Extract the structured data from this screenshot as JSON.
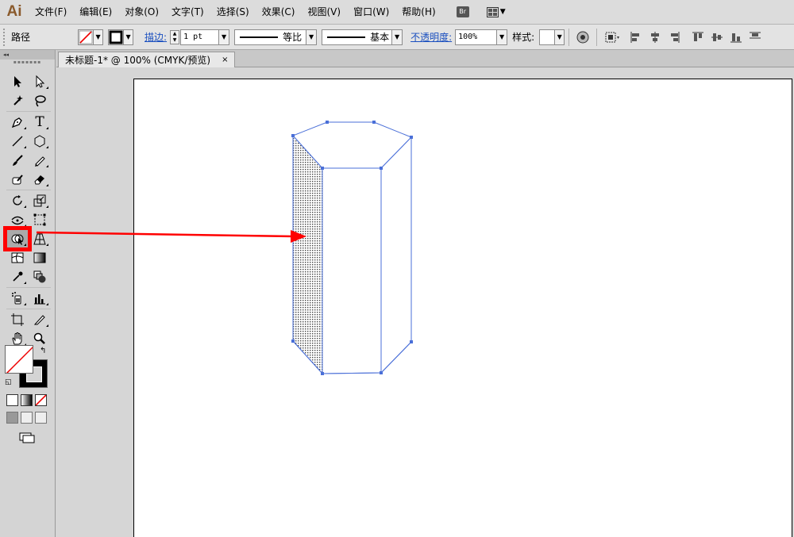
{
  "app": {
    "logo": "Ai"
  },
  "menu": {
    "items": [
      "文件(F)",
      "编辑(E)",
      "对象(O)",
      "文字(T)",
      "选择(S)",
      "效果(C)",
      "视图(V)",
      "窗口(W)",
      "帮助(H)"
    ],
    "bridge_label": "Br"
  },
  "control": {
    "selection_label": "路径",
    "stroke_label": "描边:",
    "stroke_weight": "1 pt",
    "stroke_ratio_label": "等比",
    "profile_label": "基本",
    "opacity_label": "不透明度:",
    "opacity_value": "100%",
    "style_label": "样式:"
  },
  "document": {
    "tab_title": "未标题-1* @ 100% (CMYK/预览)",
    "close_glyph": "×"
  },
  "toolpanel": {
    "collapse_glyph": "◂◂",
    "tools": [
      [
        "selection-tool",
        "direct-selection-tool"
      ],
      [
        "magic-wand-tool",
        "lasso-tool"
      ],
      [
        "pen-tool",
        "type-tool"
      ],
      [
        "line-segment-tool",
        "polygon-tool"
      ],
      [
        "paintbrush-tool",
        "pencil-tool"
      ],
      [
        "blob-brush-tool",
        "eraser-tool"
      ],
      [
        "rotate-tool",
        "scale-tool"
      ],
      [
        "width-tool",
        "free-transform-tool"
      ],
      [
        "shape-builder-tool",
        "perspective-grid-tool"
      ],
      [
        "mesh-tool",
        "gradient-tool"
      ],
      [
        "eyedropper-tool",
        "blend-tool"
      ],
      [
        "symbol-sprayer-tool",
        "column-graph-tool"
      ],
      [
        "artboard-tool",
        "slice-tool"
      ],
      [
        "hand-tool",
        "zoom-tool"
      ]
    ],
    "type_glyph": "T",
    "highlight_color": "#ff0000"
  },
  "colors": {
    "accent_link": "#1a4fbf",
    "selection_path": "#4a6fd8",
    "arrow": "#ff0000"
  }
}
